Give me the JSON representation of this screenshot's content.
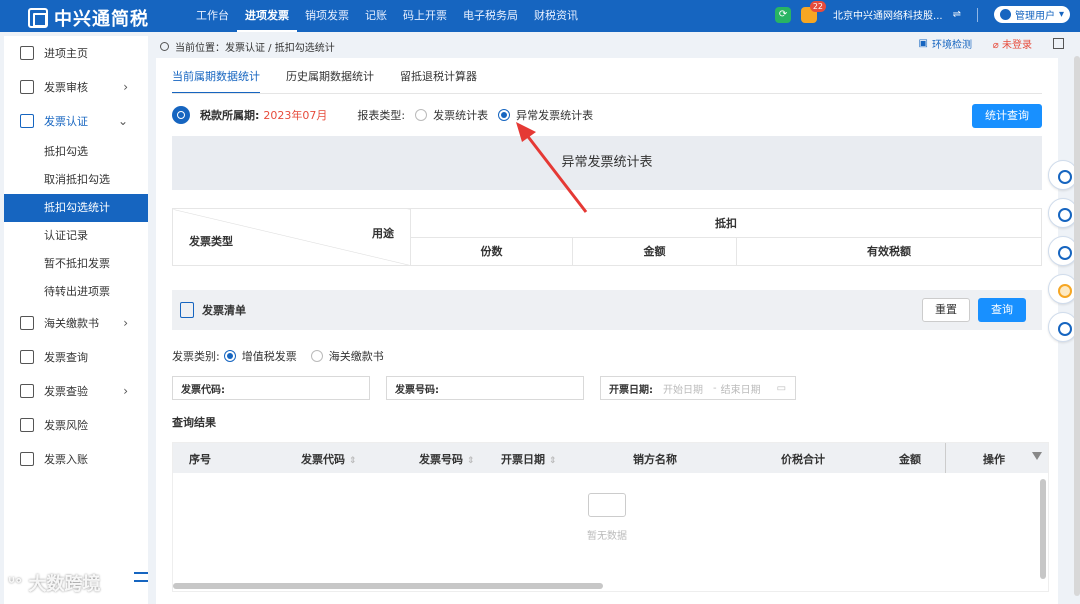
{
  "app": {
    "name": "中兴通简税"
  },
  "topnav": [
    "工作台",
    "进项发票",
    "销项发票",
    "记账",
    "码上开票",
    "电子税务局",
    "财税资讯"
  ],
  "topbar": {
    "notification_count": "22",
    "company": "北京中兴通网络科技股...",
    "switch_icon": "⇌",
    "user": "管理用户"
  },
  "sidebar": {
    "items": [
      {
        "label": "进项主页"
      },
      {
        "label": "发票审核"
      },
      {
        "label": "发票认证"
      },
      {
        "label": "海关缴款书"
      },
      {
        "label": "发票查询"
      },
      {
        "label": "发票查验"
      },
      {
        "label": "发票风险"
      },
      {
        "label": "发票入账"
      }
    ],
    "subitems": [
      "抵扣勾选",
      "取消抵扣勾选",
      "抵扣勾选统计",
      "认证记录",
      "暂不抵扣发票",
      "待转出进项票"
    ]
  },
  "breadcrumb": {
    "text": "当前位置：发票认证 / 抵扣勾选统计",
    "env": "环境检测",
    "login": "未登录"
  },
  "tabs": [
    "当前属期数据统计",
    "历史属期数据统计",
    "留抵退税计算器"
  ],
  "period": {
    "label": "税款所属期:",
    "value": "2023年07月",
    "type_label": "报表类型:",
    "opt1": "发票统计表",
    "opt2": "异常发票统计表",
    "button": "统计查询"
  },
  "report": {
    "title": "异常发票统计表",
    "col_usage": "用途",
    "col_type": "发票类型",
    "col_deduct": "抵扣",
    "col_count": "份数",
    "col_amount": "金额",
    "col_tax": "有效税额"
  },
  "invoice_list": {
    "title": "发票清单",
    "reset": "重置",
    "query": "查询",
    "cat_label": "发票类别:",
    "cat_opt1": "增值税发票",
    "cat_opt2": "海关缴款书",
    "code_label": "发票代码:",
    "num_label": "发票号码:",
    "date_label": "开票日期:",
    "date_start": "开始日期",
    "date_sep": "-",
    "date_end": "结束日期"
  },
  "results": {
    "title": "查询结果",
    "columns": [
      "序号",
      "发票代码",
      "发票号码",
      "开票日期",
      "销方名称",
      "价税合计",
      "金额",
      "操作"
    ],
    "empty": "暂无数据"
  },
  "watermark": "大数跨境"
}
